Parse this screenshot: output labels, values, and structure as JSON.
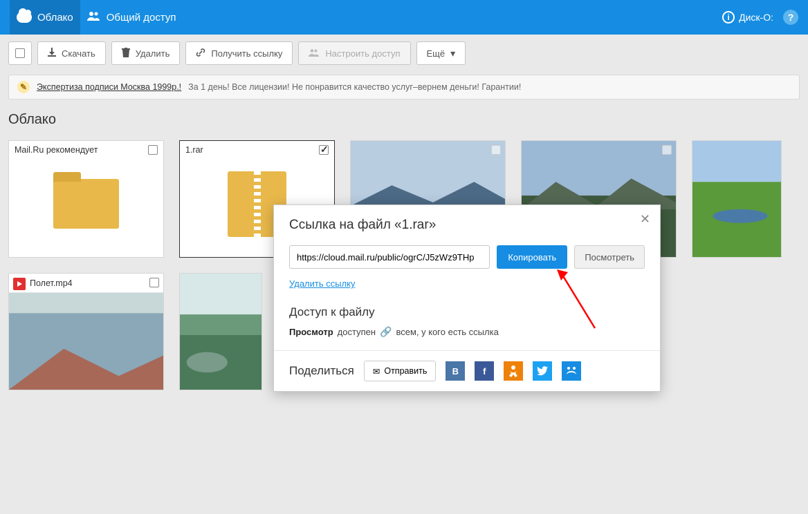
{
  "nav": {
    "cloud": "Облако",
    "shared": "Общий доступ",
    "disko": "Диск-О:"
  },
  "toolbar": {
    "download": "Скачать",
    "delete": "Удалить",
    "getlink": "Получить ссылку",
    "access": "Настроить доступ",
    "more": "Ещё"
  },
  "ad": {
    "title": "Экспертиза подписи Москва 1999р.!",
    "body": "За 1 день! Все лицензии! Не понравится качество услуг–вернем деньги! Гарантии!"
  },
  "crumb": "Облако",
  "items": {
    "folder_rec": "Mail.Ru рекомендует",
    "archive_name": "1.rar",
    "video_name": "Полет.mp4"
  },
  "modal": {
    "title": "Ссылка на файл «1.rar»",
    "url": "https://cloud.mail.ru/public/ogrC/J5zWz9THp",
    "copy": "Копировать",
    "view": "Посмотреть",
    "delete_link": "Удалить ссылку",
    "access_title": "Доступ к файлу",
    "access_bold": "Просмотр",
    "access_rest": "доступен",
    "access_who": "всем, у кого есть ссылка",
    "share_title": "Поделиться",
    "send": "Отправить"
  }
}
